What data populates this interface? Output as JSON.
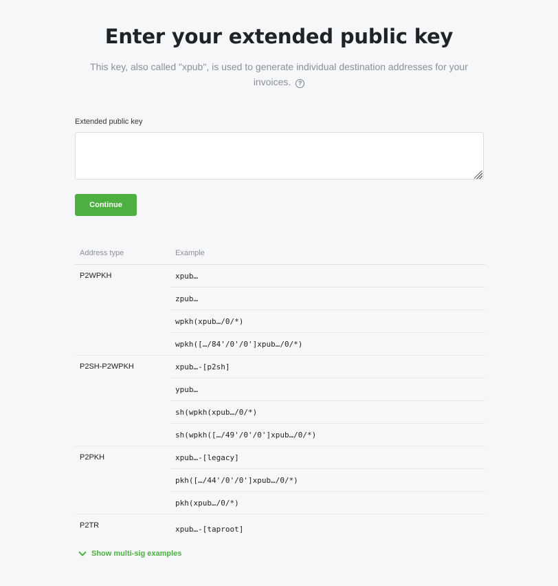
{
  "header": {
    "title": "Enter your extended public key",
    "subtitle": "This key, also called \"xpub\", is used to generate individual destination addresses for your invoices.",
    "help_icon": "question-circle-icon"
  },
  "form": {
    "label": "Extended public key",
    "value": "",
    "submit_label": "Continue"
  },
  "table": {
    "columns": [
      "Address type",
      "Example"
    ],
    "groups": [
      {
        "type": "P2WPKH",
        "examples": [
          "xpub…",
          "zpub…",
          "wpkh(xpub…/0/*)",
          "wpkh([…/84'/0'/0']xpub…/0/*)"
        ]
      },
      {
        "type": "P2SH-P2WPKH",
        "examples": [
          "xpub…-[p2sh]",
          "ypub…",
          "sh(wpkh(xpub…/0/*)",
          "sh(wpkh([…/49'/0'/0']xpub…/0/*)"
        ]
      },
      {
        "type": "P2PKH",
        "examples": [
          "xpub…-[legacy]",
          "pkh([…/44'/0'/0']xpub…/0/*)",
          "pkh(xpub…/0/*)"
        ]
      },
      {
        "type": "P2TR",
        "examples": [
          "xpub…-[taproot]"
        ]
      }
    ]
  },
  "multisig": {
    "label": "Show multi-sig examples",
    "icon": "chevron-down-icon"
  },
  "colors": {
    "accent": "#4caf3f",
    "background": "#f6f7f9",
    "muted_text": "#8a8f96"
  }
}
